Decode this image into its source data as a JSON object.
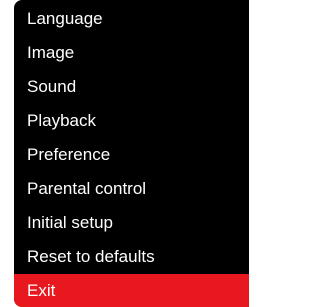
{
  "menu": {
    "items": [
      {
        "label": "Language"
      },
      {
        "label": "Image"
      },
      {
        "label": "Sound"
      },
      {
        "label": "Playback"
      },
      {
        "label": "Preference"
      },
      {
        "label": "Parental control"
      },
      {
        "label": "Initial setup"
      },
      {
        "label": "Reset to defaults"
      },
      {
        "label": "Exit"
      }
    ],
    "selected_index": 8
  },
  "colors": {
    "menu_background": "#000000",
    "text": "#ffffff",
    "highlight": "#e8191e"
  }
}
